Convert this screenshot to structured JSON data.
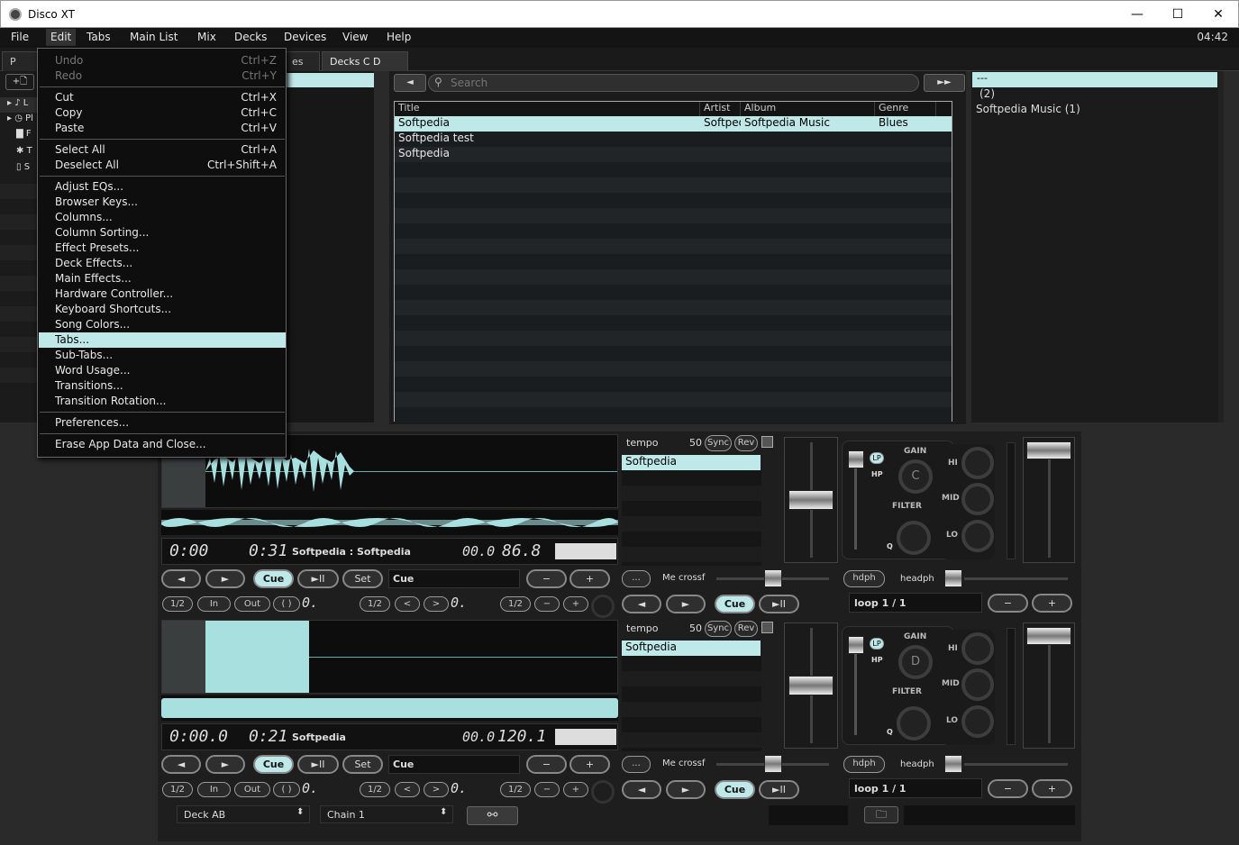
{
  "window": {
    "title": "Disco XT",
    "minimize": "—",
    "maximize": "☐",
    "close": "✕"
  },
  "menubar": {
    "items": [
      "File",
      "Edit",
      "Tabs",
      "Main List",
      "Mix",
      "Decks",
      "Devices",
      "View",
      "Help"
    ],
    "clock": "04:42"
  },
  "tabs": {
    "left": "P",
    "middle": "es",
    "active": "Decks C D"
  },
  "edit_menu": {
    "items": [
      {
        "label": "Undo",
        "shortcut": "Ctrl+Z",
        "disabled": true
      },
      {
        "label": "Redo",
        "shortcut": "Ctrl+Y",
        "disabled": true
      },
      {
        "label": "Cut",
        "shortcut": "Ctrl+X"
      },
      {
        "label": "Copy",
        "shortcut": "Ctrl+C"
      },
      {
        "label": "Paste",
        "shortcut": "Ctrl+V"
      },
      {
        "label": "Select All",
        "shortcut": "Ctrl+A"
      },
      {
        "label": "Deselect All",
        "shortcut": "Ctrl+Shift+A"
      },
      {
        "label": "Adjust EQs..."
      },
      {
        "label": "Browser Keys..."
      },
      {
        "label": "Columns..."
      },
      {
        "label": "Column Sorting..."
      },
      {
        "label": "Effect Presets..."
      },
      {
        "label": "Deck Effects..."
      },
      {
        "label": "Main Effects..."
      },
      {
        "label": "Hardware Controller..."
      },
      {
        "label": "Keyboard Shortcuts..."
      },
      {
        "label": "Song Colors..."
      },
      {
        "label": "Tabs...",
        "highlighted": true
      },
      {
        "label": "Sub-Tabs..."
      },
      {
        "label": "Word Usage..."
      },
      {
        "label": "Transitions..."
      },
      {
        "label": "Transition Rotation..."
      },
      {
        "label": "Preferences..."
      },
      {
        "label": "Erase App Data and Close..."
      }
    ]
  },
  "left_tree": {
    "add_label": "+🗋",
    "items": [
      "L",
      "Pl",
      "F",
      "T",
      "S"
    ]
  },
  "library": {
    "search_placeholder": "Search",
    "prev": "◄",
    "next": "►►",
    "columns": [
      "Title",
      "Artist",
      "Album",
      "Genre"
    ],
    "rows": [
      {
        "title": "Softpedia",
        "artist": "Softpedia",
        "album": "Softpedia Music",
        "genre": "Blues",
        "selected": true
      },
      {
        "title": "Softpedia test",
        "artist": "",
        "album": "",
        "genre": ""
      },
      {
        "title": "Softpedia",
        "artist": "",
        "album": "",
        "genre": ""
      }
    ]
  },
  "right_list": {
    "items": [
      "---",
      "(2)",
      "Softpedia Music (1)"
    ]
  },
  "deck_c": {
    "time_elapsed": "0:00",
    "time_remaining": "0:31",
    "track": "Softpedia : Softpedia",
    "pitch": "00.0",
    "bpm": "86.8",
    "cue_label": "Cue",
    "tempo_label": "tempo",
    "tempo_value": "50",
    "sync": "Sync",
    "rev": "Rev",
    "playlist_item": "Softpedia",
    "letter": "C",
    "crossfader": "Me crossf",
    "hdph": "hdph",
    "headph": "headph",
    "loop": "loop 1 / 1"
  },
  "deck_d": {
    "time_elapsed": "0:00.0",
    "time_remaining": "0:21",
    "track": "Softpedia",
    "pitch": "00.0",
    "bpm": "120.1",
    "cue_label": "Cue",
    "tempo_label": "tempo",
    "tempo_value": "50",
    "sync": "Sync",
    "rev": "Rev",
    "playlist_item": "Softpedia",
    "letter": "D",
    "crossfader": "Me crossf",
    "hdph": "hdph",
    "headph": "headph",
    "loop": "loop 1 / 1"
  },
  "transport": {
    "prev": "◄",
    "play_fwd": "►",
    "cue": "Cue",
    "playpause": "►II",
    "set": "Set",
    "minus": "−",
    "plus": "+",
    "more": "...",
    "half": "1/2",
    "in": "In",
    "out": "Out",
    "loop_paren": "( )",
    "zero": "0.",
    "lt": "<",
    "gt": ">"
  },
  "mixer": {
    "gain": "GAIN",
    "filter": "FILTER",
    "hi": "HI",
    "mid": "MID",
    "lo": "LO",
    "lp": "LP",
    "hp": "HP",
    "q": "Q"
  },
  "footer": {
    "deck_select": "Deck AB",
    "chain_select": "Chain 1",
    "folder_icon": "🗀"
  },
  "colors": {
    "accent": "#bfe9e9",
    "wave": "#a8e0e0",
    "bg": "#1e1e1e"
  }
}
